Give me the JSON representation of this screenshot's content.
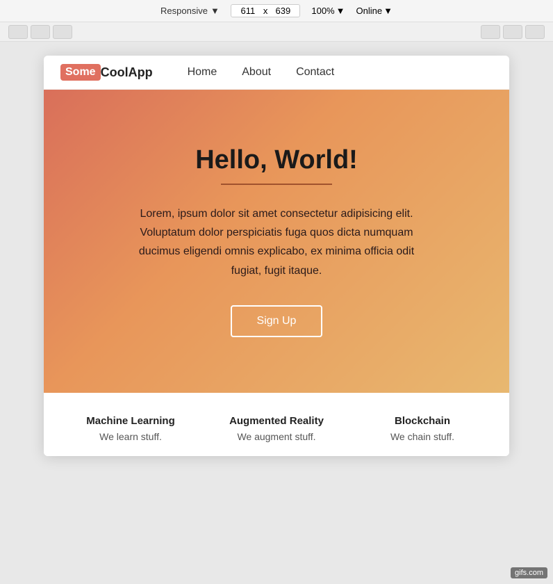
{
  "toolbar": {
    "responsive_label": "Responsive",
    "width_value": "611",
    "height_value": "639",
    "separator": "x",
    "zoom_label": "100%",
    "online_label": "Online"
  },
  "nav": {
    "brand_some": "Some",
    "brand_rest": "CoolApp",
    "links": [
      {
        "label": "Home"
      },
      {
        "label": "About"
      },
      {
        "label": "Contact"
      }
    ]
  },
  "hero": {
    "title": "Hello, World!",
    "body": "Lorem, ipsum dolor sit amet consectetur adipisicing elit. Voluptatum dolor perspiciatis fuga quos dicta numquam ducimus eligendi omnis explicabo, ex minima officia odit fugiat, fugit itaque.",
    "button_label": "Sign Up"
  },
  "features": [
    {
      "title": "Machine Learning",
      "desc": "We learn stuff."
    },
    {
      "title": "Augmented Reality",
      "desc": "We augment stuff."
    },
    {
      "title": "Blockchain",
      "desc": "We chain stuff."
    }
  ],
  "watermark": "gifs.com"
}
